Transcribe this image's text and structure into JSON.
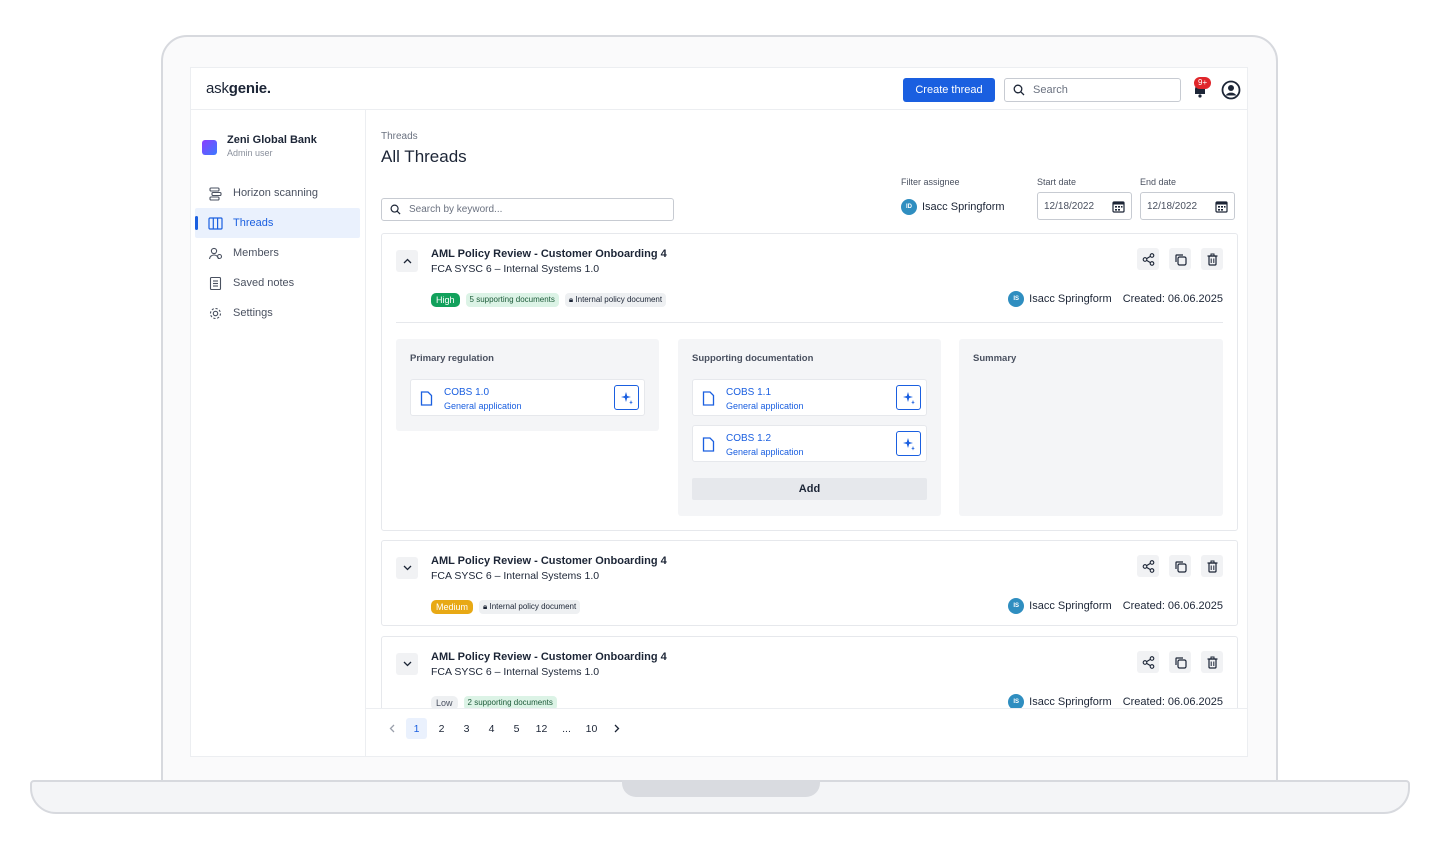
{
  "app": {
    "logo_prefix": "ask",
    "logo_suffix": "genie.",
    "create_thread_label": "Create thread",
    "search_placeholder": "Search",
    "notification_badge": "9+"
  },
  "sidebar": {
    "org_name": "Zeni Global Bank",
    "org_role": "Admin user",
    "items": [
      {
        "label": "Horizon scanning",
        "icon": "horizon-icon"
      },
      {
        "label": "Threads",
        "icon": "columns-icon",
        "active": true
      },
      {
        "label": "Members",
        "icon": "members-icon"
      },
      {
        "label": "Saved notes",
        "icon": "notes-icon"
      },
      {
        "label": "Settings",
        "icon": "gear-icon"
      }
    ]
  },
  "main": {
    "breadcrumb": "Threads",
    "title": "All Threads",
    "keyword_placeholder": "Search by keyword...",
    "filter_assignee_label": "Filter assignee",
    "assignee_initials": "ID",
    "assignee_name": "Isacc Springform",
    "start_date_label": "Start date",
    "start_date_value": "12/18/2022",
    "end_date_label": "End date",
    "end_date_value": "12/18/2022"
  },
  "threads": [
    {
      "title": "AML Policy Review - Customer Onboarding 4",
      "subtitle": "FCA SYSC 6 – Internal Systems 1.0",
      "priority": "High",
      "tag_supporting": "5 supporting documents",
      "tag_internal": "Internal policy document",
      "owner_initials": "IS",
      "owner_name": "Isacc Springform",
      "created": "Created: 06.06.2025",
      "expanded": true,
      "primary_regulation_label": "Primary regulation",
      "supporting_documentation_label": "Supporting documentation",
      "summary_label": "Summary",
      "primary_docs": [
        {
          "name": "COBS 1.0",
          "sub": "General application"
        }
      ],
      "supporting_docs": [
        {
          "name": "COBS 1.1",
          "sub": "General application"
        },
        {
          "name": "COBS 1.2",
          "sub": "General application"
        }
      ],
      "add_label": "Add"
    },
    {
      "title": "AML Policy Review - Customer Onboarding 4",
      "subtitle": "FCA SYSC 6 – Internal Systems 1.0",
      "priority": "Medium",
      "tag_internal": "Internal policy document",
      "owner_initials": "IS",
      "owner_name": "Isacc Springform",
      "created": "Created: 06.06.2025"
    },
    {
      "title": "AML Policy Review - Customer Onboarding 4",
      "subtitle": "FCA SYSC 6 – Internal Systems 1.0",
      "priority": "Low",
      "tag_supporting": "2 supporting documents",
      "owner_initials": "IS",
      "owner_name": "Isacc Springform",
      "created": "Created: 06.06.2025"
    }
  ],
  "pagination": {
    "pages": [
      "1",
      "2",
      "3",
      "4",
      "5",
      "12",
      "...",
      "10"
    ],
    "current": "1"
  },
  "colors": {
    "accent": "#1a5fe0",
    "high": "#12a15c",
    "medium": "#e8a915",
    "avatar": "#2f8ec0",
    "badge": "#e0262b"
  }
}
